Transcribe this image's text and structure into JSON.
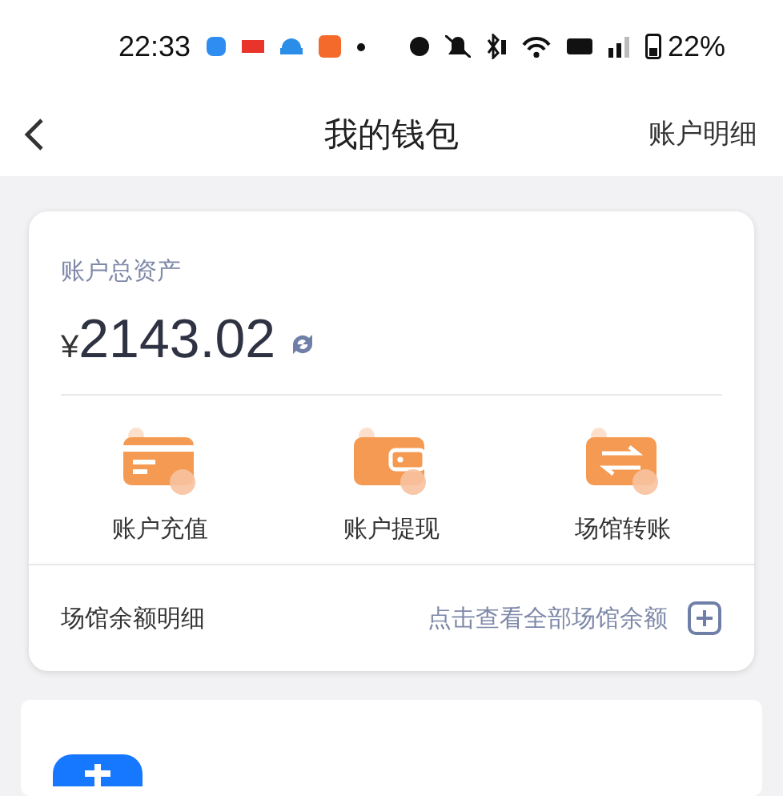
{
  "status_bar": {
    "time": "22:33",
    "battery": "22%"
  },
  "nav": {
    "title": "我的钱包",
    "action": "账户明细"
  },
  "wallet": {
    "label": "账户总资产",
    "currency": "¥",
    "amount": "2143.02",
    "actions": [
      {
        "kind": "card",
        "label": "账户充值"
      },
      {
        "kind": "wallet",
        "label": "账户提现"
      },
      {
        "kind": "transfer",
        "label": "场馆转账"
      }
    ],
    "footer": {
      "label": "场馆余额明细",
      "link": "点击查看全部场馆余额"
    }
  }
}
